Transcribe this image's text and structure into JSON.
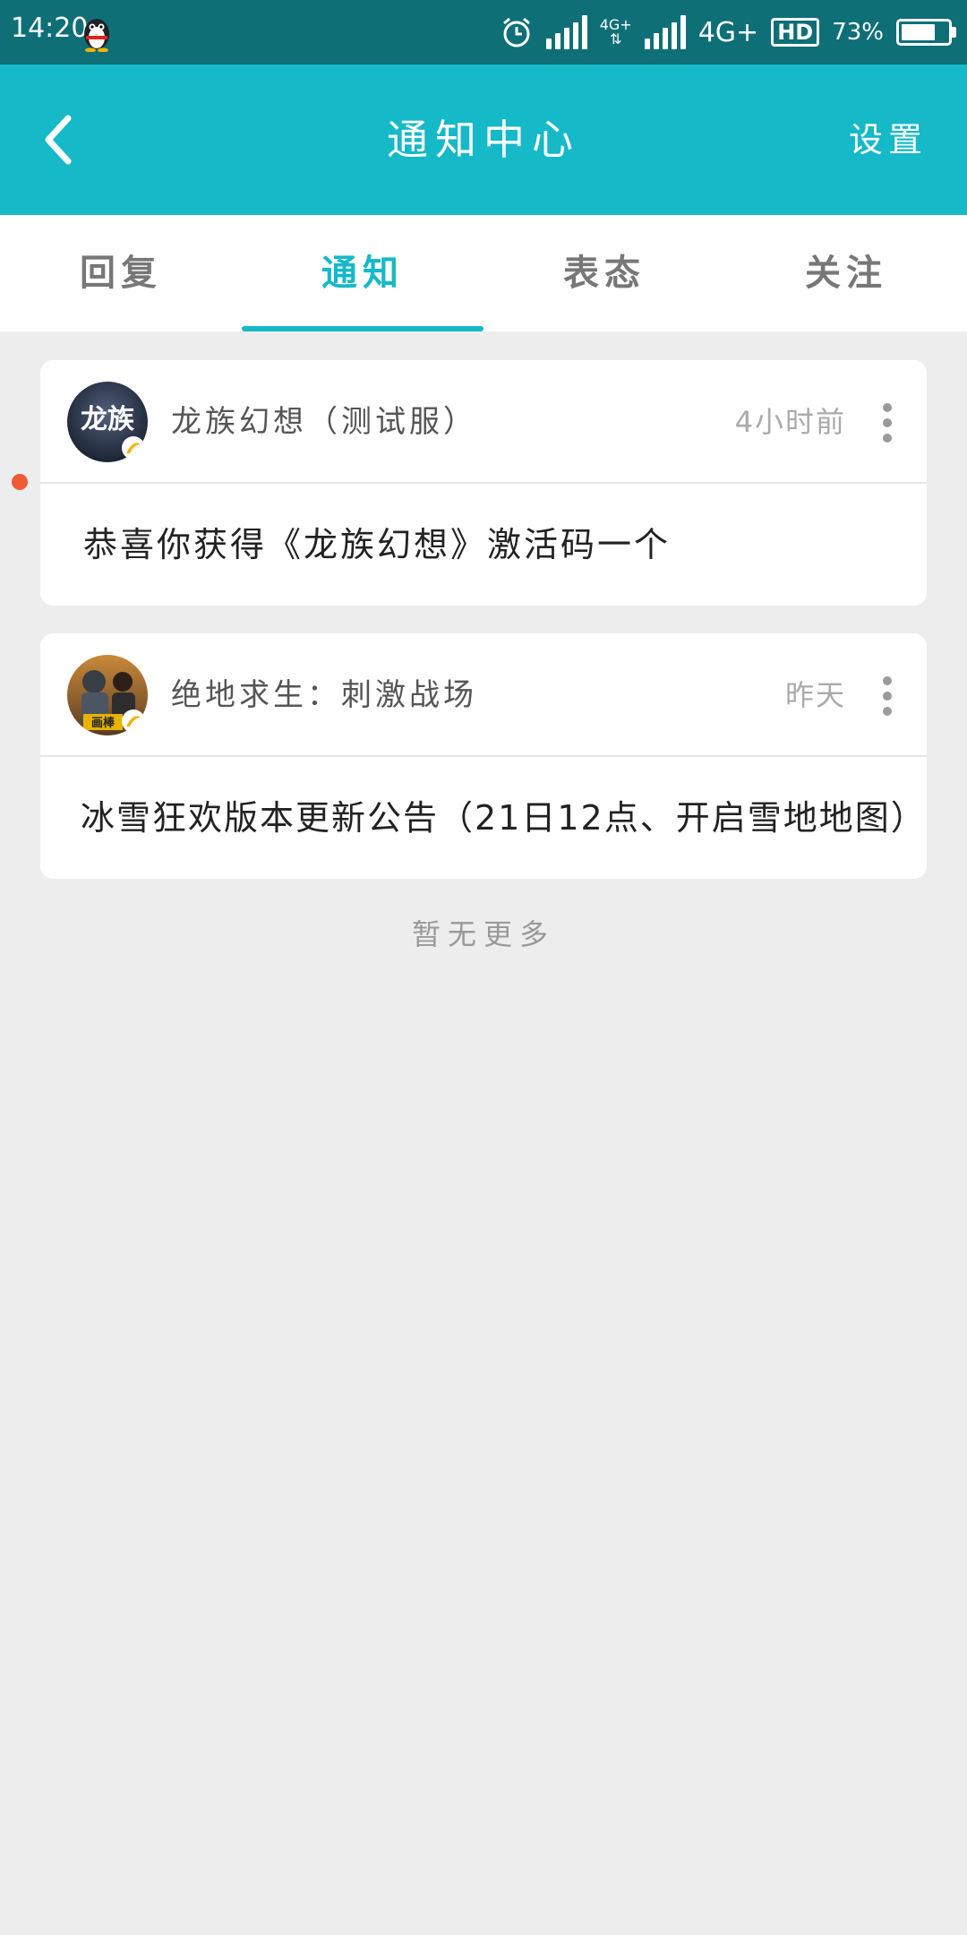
{
  "status_bar": {
    "time": "14:20",
    "network_small": "4G+",
    "network": "4G+",
    "hd": "HD",
    "battery_text": "73%",
    "battery_level": 0.73,
    "icons": [
      "qq-penguin-icon",
      "alarm-icon",
      "signal-icon",
      "signal-icon",
      "battery-icon"
    ]
  },
  "header": {
    "title": "通知中心",
    "settings_label": "设置",
    "back_icon": "chevron-left-icon"
  },
  "tabs": [
    {
      "label": "回复",
      "active": false
    },
    {
      "label": "通知",
      "active": true
    },
    {
      "label": "表态",
      "active": false
    },
    {
      "label": "关注",
      "active": false
    }
  ],
  "notifications": [
    {
      "name": "龙族幻想（测试服）",
      "time": "4小时前",
      "message": "恭喜你获得《龙族幻想》激活码一个",
      "unread": true,
      "avatar_text": "龙族"
    },
    {
      "name": "绝地求生：刺激战场",
      "time": "昨天",
      "message": "冰雪狂欢版本更新公告（21日12点、开启雪地地图）",
      "unread": false,
      "avatar_text": "画棒"
    }
  ],
  "footer": {
    "no_more": "暂无更多"
  },
  "colors": {
    "status_bar": "#0e6f77",
    "accent": "#15b9c8",
    "unread_dot": "#f05a35",
    "background": "#ededed"
  }
}
